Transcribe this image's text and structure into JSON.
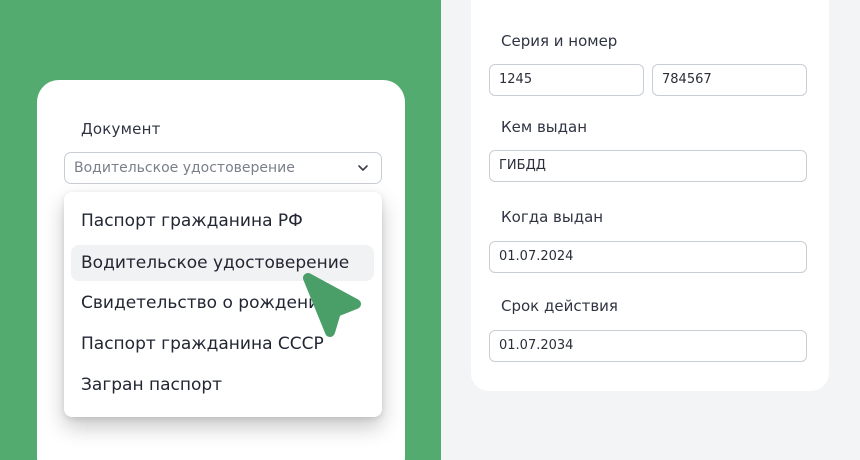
{
  "document_card": {
    "label": "Документ",
    "select_value": "Водительское удостоверение",
    "options": [
      "Паспорт гражданина РФ",
      "Водительское удостоверение",
      "Свидетельство о рождении",
      "Паспорт гражданина СССР",
      "Загран паспорт"
    ],
    "selected_index": 1
  },
  "form": {
    "series_label": "Серия и номер",
    "series_value": "1245",
    "number_value": "784567",
    "issued_by_label": "Кем выдан",
    "issued_by_value": "ГИБДД",
    "issue_date_label": "Когда выдан",
    "issue_date_value": "01.07.2024",
    "expiry_label": "Срок действия",
    "expiry_value": "01.07.2034"
  },
  "colors": {
    "brand_green": "#54ab6f",
    "cursor_green": "#4a9f69"
  },
  "icons": {
    "select_chevron": "chevron-down-icon",
    "pointer": "cursor-arrow-icon"
  }
}
